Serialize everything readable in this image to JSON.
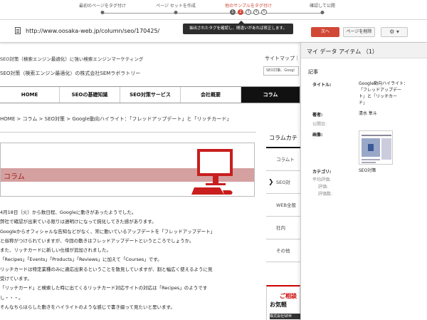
{
  "stepper": {
    "steps": [
      {
        "label": "最初のページをタグ付け",
        "state": "done"
      },
      {
        "label": "ページ セットを作成",
        "state": "done"
      },
      {
        "label": "他のサンプルをタグ付け",
        "state": "current"
      },
      {
        "label": "確認して公開",
        "state": "pending"
      }
    ],
    "sample_pills": [
      "1",
      "2",
      "3",
      "4",
      "5"
    ],
    "current_pill": "2"
  },
  "toolbar": {
    "url": "http://www.oosaka-web.jp/column/seo/170425/",
    "tooltip": "抽出されたタグを確認し、間違いがあれば修正します。",
    "next_label": "次へ",
    "delete_label": "ページを削除",
    "gear_caret": "▾"
  },
  "site": {
    "tagline": "SEO対策（検索エンジン最適化）に強い検索エンジンマーケティング",
    "company": "SEO対策（検索エンジン最適化）の株式会社SEMラボラトリー",
    "sitemap": "サイトマップ｜",
    "search_placeholder": "SEO対策、Googl",
    "nav": [
      "HOME",
      "SEOの基礎知識",
      "SEO対策サービス",
      "会社概要",
      "コラム"
    ],
    "breadcrumb": "HOME > コラム > SEO対策 > Google動向ハイライト：「フレッドアップデート」と「リッチカード」",
    "hero_title": "コラム",
    "article_lines": [
      "4月18日（火）から数日程、Googleに動きがあったようでした。",
      "弊社で確認が出来ている限りは週明けになって鈍化してきた感があります。",
      "Googleからオフィシャルな告知などがなく、常に動いているアップデートを「フレッドアップデート」",
      "と俗称がつけられていますが、今回の動きはフレッドアップデートというところでしょうか。",
      "また、リッチカードに新しい仕様が追加されました。",
      "「Recipes」「Events」「Products」「Reviews」に加えて「Courses」です。",
      "リッチカードは特定業種のみに適応出来るということを散見していますが、割と幅広く使えるように見",
      "受けています。",
      "「リッチカード」と検索した時に出てくるリッチカード対応サイトの対応は「Recipes」のようです",
      "し・・・。",
      "そんなちらほらした動きをハイライトのような感じで書き綴って見たいと思います。"
    ],
    "side_title": "コラムカテ",
    "side_items": [
      "コラムト",
      "SEO対",
      "WEB全般",
      "社内",
      "その他"
    ],
    "consult_line1": "ご相談",
    "consult_line2": "お気軽",
    "consult_bar": "株式会社SEM"
  },
  "panel": {
    "title": "マイ データ アイテム （1）",
    "card_header": "記事",
    "fields": {
      "title_label": "タイトル:",
      "title_value_lines": [
        "Google動向ハイライト：",
        "「フレッドアップデー",
        "ト」と「リッチカー",
        "ド」"
      ],
      "author_label": "著者:",
      "author_value": "清水 隼斗",
      "published_label": "公開日:",
      "image_label": "画像:",
      "category_label": "カテゴリ:",
      "category_value": "SEO対策",
      "avg_rating_label": "平均評価:",
      "rating_label": "評価:",
      "rating_count_label": "評価数:"
    }
  },
  "colors": {
    "accent": "#d14836",
    "nav_active": "#111111",
    "hero_band": "#d5a0a0",
    "hero_icon": "#c81e1e"
  }
}
